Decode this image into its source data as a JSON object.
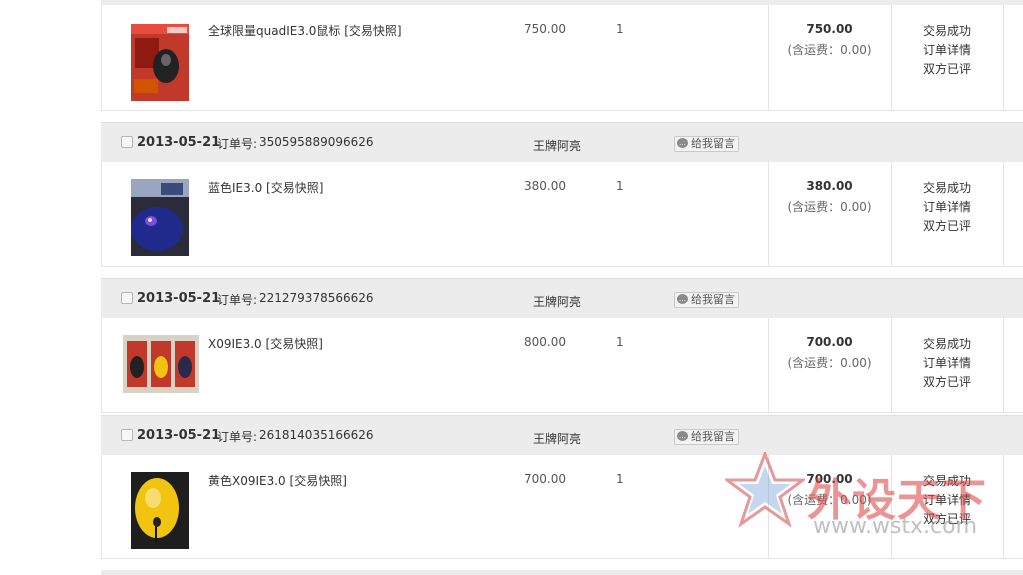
{
  "labels": {
    "order_no_label": "订单号:",
    "leave_message": "给我留言",
    "snapshot": "[交易快照]",
    "status_success": "交易成功",
    "status_detail": "订单详情",
    "status_reviewed": "双方已评"
  },
  "orders": [
    {
      "date": "",
      "order_no": "",
      "seller": "",
      "item_title": "全球限量quadIE3.0鼠标 [交易快照]",
      "unit_price": "750.00",
      "quantity": "1",
      "total": "750.00",
      "shipping": "(含运费：0.00)"
    },
    {
      "date": "2013-05-21",
      "order_no": "350595889096626",
      "seller": "王牌阿亮",
      "item_title": "蓝色IE3.0 [交易快照]",
      "unit_price": "380.00",
      "quantity": "1",
      "total": "380.00",
      "shipping": "(含运费：0.00)"
    },
    {
      "date": "2013-05-21",
      "order_no": "221279378566626",
      "seller": "王牌阿亮",
      "item_title": "X09IE3.0 [交易快照]",
      "unit_price": "800.00",
      "quantity": "1",
      "total": "700.00",
      "shipping": "(含运费：0.00)"
    },
    {
      "date": "2013-05-21",
      "order_no": "261814035166626",
      "seller": "王牌阿亮",
      "item_title": "黄色X09IE3.0 [交易快照]",
      "unit_price": "700.00",
      "quantity": "1",
      "total": "700.00",
      "shipping": "(含运费：0.00)"
    }
  ],
  "watermark": {
    "brand": "外设天下",
    "url": "www.wstx.com"
  },
  "colors": {
    "header_bg": "#ececec",
    "border": "#e4e4e4",
    "watermark_red": "#dc3c3c"
  }
}
